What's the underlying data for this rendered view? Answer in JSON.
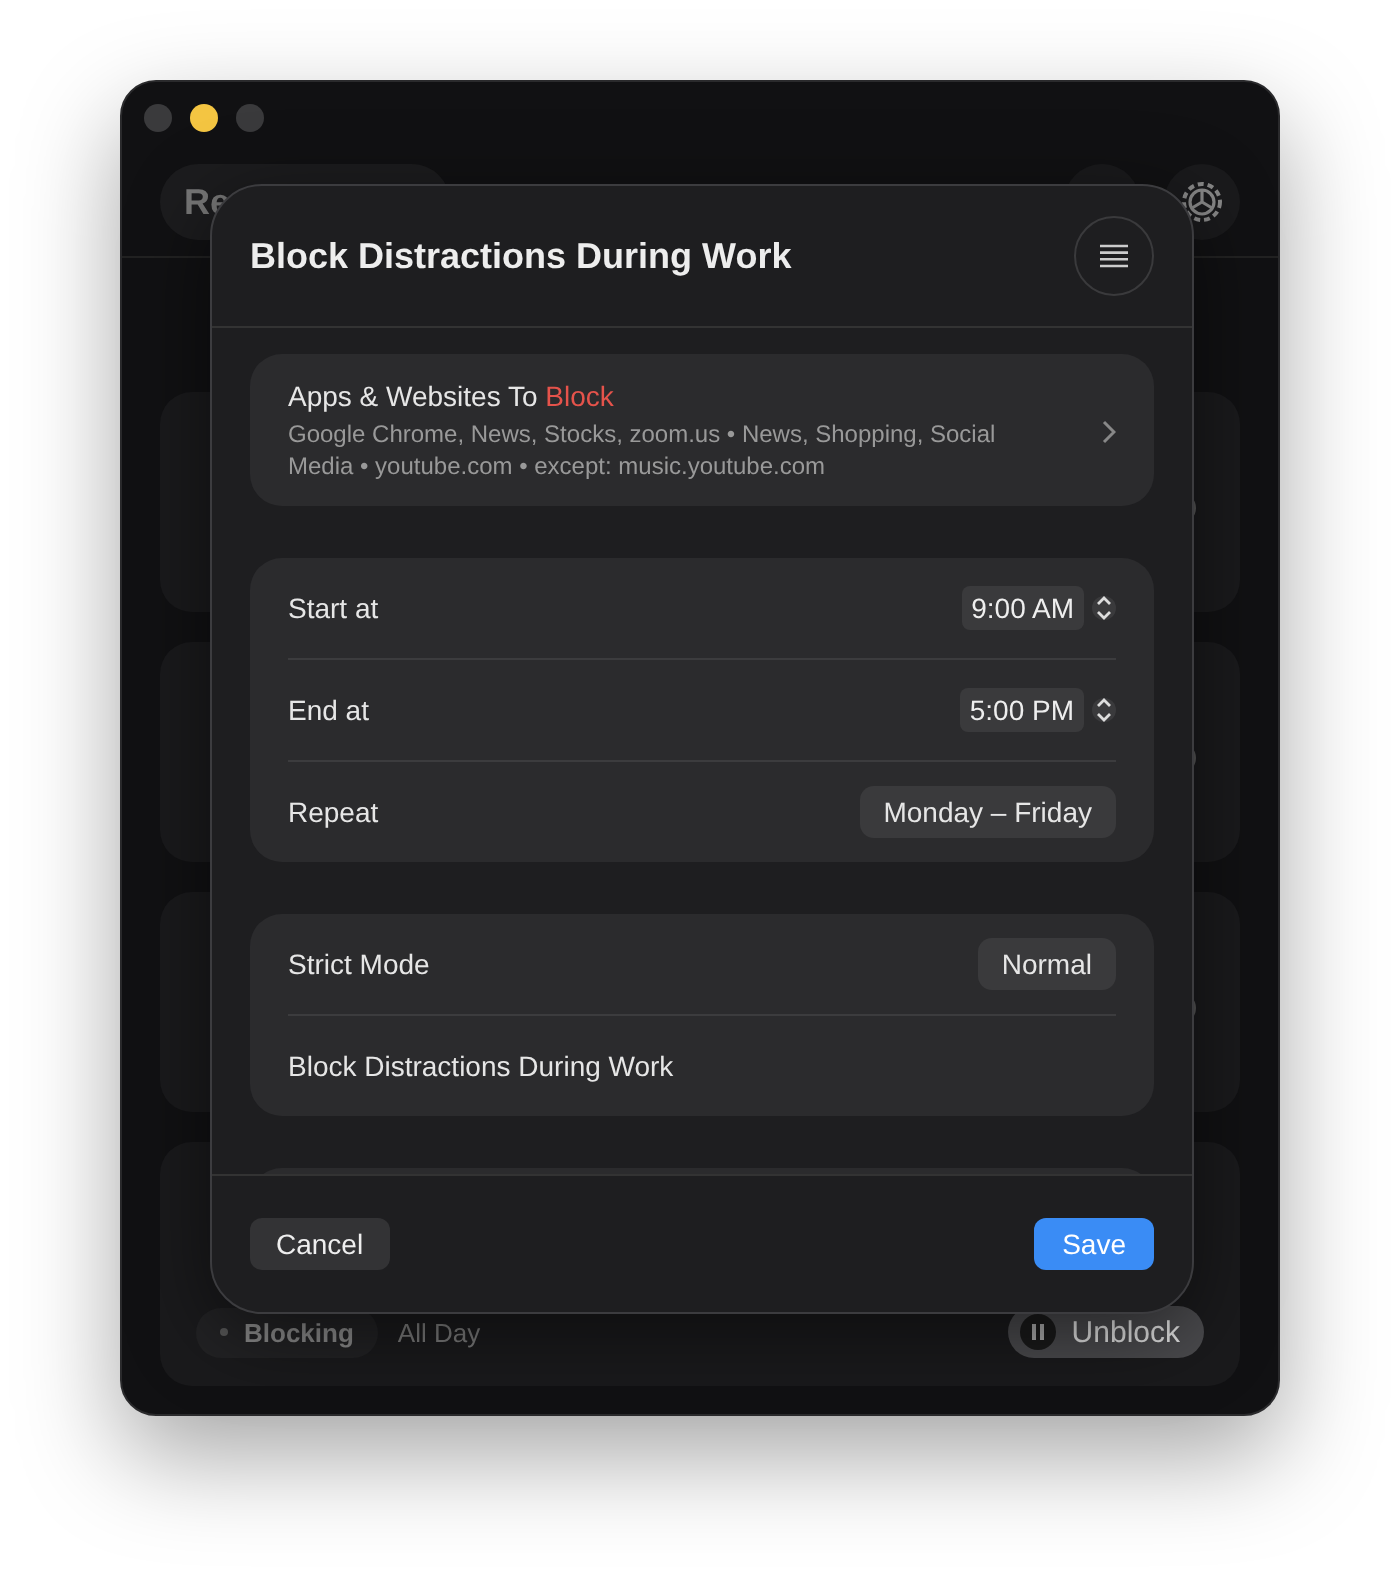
{
  "window": {
    "traffic_lights": [
      {
        "color": "#3a3a3c"
      },
      {
        "color": "#f4c542"
      },
      {
        "color": "#3a3a3c"
      }
    ],
    "search_text": "Re",
    "cards": [
      {
        "kind": "toggle"
      },
      {
        "kind": "toggle"
      },
      {
        "kind": "toggle"
      },
      {
        "kind": "active"
      }
    ],
    "last_card": {
      "status": "Blocking",
      "schedule": "All Day",
      "action": "Unblock"
    }
  },
  "sheet": {
    "title": "Block Distractions During Work",
    "blocklist": {
      "title": "Apps & Websites To ",
      "title_highlight": "Block",
      "summary": "Google Chrome, News, Stocks, zoom.us • News, Shopping, Social Media • youtube.com • except: music.youtube.com"
    },
    "groups": [
      [
        {
          "kind": "time",
          "label": "Start at",
          "value": "9:00 AM"
        },
        {
          "kind": "time",
          "label": "End at",
          "value": "5:00 PM"
        },
        {
          "kind": "select",
          "label": "Repeat",
          "value": "Monday – Friday"
        }
      ],
      [
        {
          "kind": "select",
          "label": "Strict Mode",
          "value": "Normal"
        },
        {
          "kind": "text",
          "label": "Block Distractions During Work"
        }
      ]
    ],
    "buttons": {
      "cancel": "Cancel",
      "save": "Save"
    }
  }
}
